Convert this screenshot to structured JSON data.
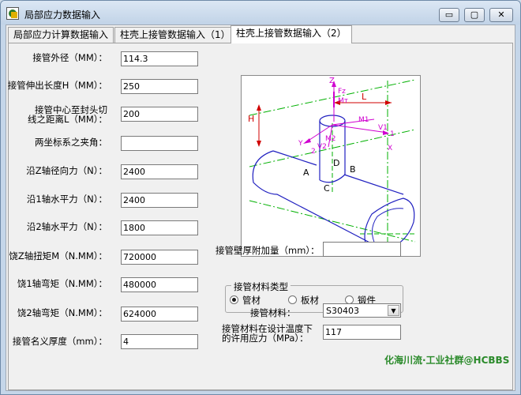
{
  "window": {
    "title": "局部应力数据输入"
  },
  "caption_buttons": {
    "minimize": "▭",
    "maximize": "▢",
    "close": "✕"
  },
  "tabs": [
    {
      "label": "局部应力计算数据输入"
    },
    {
      "label": "柱壳上接管数据输入（1）"
    },
    {
      "label": "柱壳上接管数据输入（2）"
    }
  ],
  "fields": [
    {
      "label": "接管外径（MM）：",
      "value": "114.3"
    },
    {
      "label": "接管伸出长度H（MM）：",
      "value": "250"
    },
    {
      "label_line1": "接管中心至封头切",
      "label_line2": "线之距离L（MM）：",
      "value": "200"
    },
    {
      "label": "两坐标系之夹角：",
      "value": ""
    },
    {
      "label": "沿Z轴径向力（N）：",
      "value": "2400"
    },
    {
      "label": "沿1轴水平力（N）：",
      "value": "2400"
    },
    {
      "label": "沿2轴水平力（N）：",
      "value": "1800"
    },
    {
      "label": "饶Z轴扭矩M（N.MM）：",
      "value": "720000"
    },
    {
      "label": "饶1轴弯矩（N.MM）：",
      "value": "480000"
    },
    {
      "label": "饶2轴弯矩（N.MM）：",
      "value": "624000"
    },
    {
      "label": "接管名义厚度（mm）：",
      "value": "4"
    }
  ],
  "right": {
    "thickness_label": "接管壁厚附加量（mm）：",
    "thickness_value": "",
    "group_title": "接管材料类型",
    "options": [
      "管材",
      "板材",
      "锻件"
    ],
    "selected": 0,
    "material_label": "接管材料：",
    "material_value": "S30403",
    "stress_label_line1": "接管材料在设计温度下",
    "stress_label_line2": "的许用应力（MPa）：",
    "stress_value": "117"
  },
  "figure_labels": {
    "z": "Z",
    "fz": "Fz",
    "mt": "Mт",
    "l": "L",
    "h": "H",
    "m1": "M1",
    "v1": "V1",
    "one": "1",
    "x": "X",
    "y": "Y",
    "two": "2",
    "v2": "V2",
    "m2": "M2",
    "a": "A",
    "b": "B",
    "c": "C",
    "d": "D"
  },
  "watermark": "化海川流·工业社群@HCBBS",
  "colors": {
    "accent_green": "#2a8a2a",
    "axis_magenta": "#d000d0",
    "dim_red": "#d00000",
    "centerline_green": "#00b000",
    "outline_blue": "#2020c0"
  }
}
